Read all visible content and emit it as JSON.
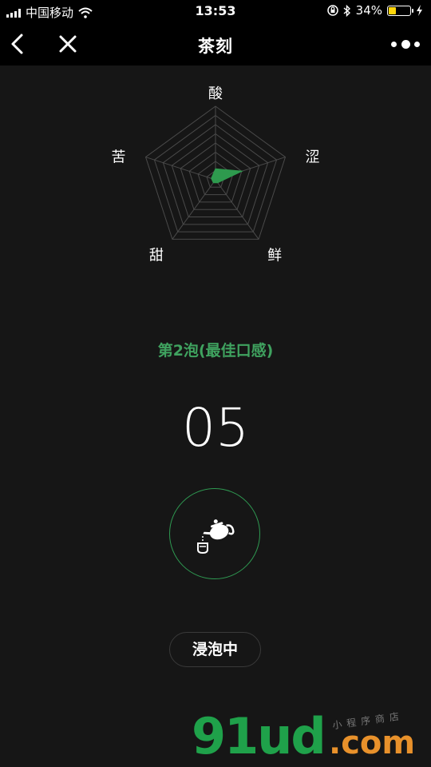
{
  "status_bar": {
    "carrier": "中国移动",
    "time": "13:53",
    "battery_percent": "34%",
    "battery_level": 0.34,
    "icons": [
      "signal-icon",
      "wifi-icon",
      "orientation-lock-icon",
      "bluetooth-icon",
      "battery-icon",
      "charging-icon"
    ]
  },
  "navbar": {
    "title": "茶刻",
    "back_icon": "chevron-left-icon",
    "close_icon": "close-icon",
    "more_icon": "more-dots-icon"
  },
  "radar": {
    "labels": [
      "酸",
      "涩",
      "鲜",
      "甜",
      "苦"
    ],
    "levels": 8,
    "values": [
      0.15,
      0.38,
      0.05,
      0.05,
      0.06
    ],
    "fill_color": "#2e9a4e",
    "grid_color": "#4a4a4a"
  },
  "brew": {
    "label": "第2泡(最佳口感)",
    "timer": "05",
    "action_icon": "teapot-pour-icon",
    "status": "浸泡中",
    "accent_color": "#3fa25f"
  },
  "watermark": {
    "main": "91ud",
    "domain": ".com",
    "sub": "小程序商店"
  }
}
